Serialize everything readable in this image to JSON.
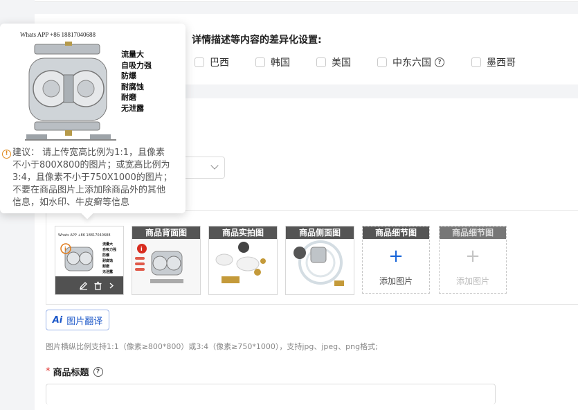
{
  "region_section": {
    "title": "详情描述等内容的差异化设置:",
    "regions": [
      {
        "label": "巴西",
        "checked": false
      },
      {
        "label": "韩国",
        "checked": false
      },
      {
        "label": "美国",
        "checked": false
      },
      {
        "label": "中东六国",
        "checked": false,
        "help_icon": "question-circle-icon"
      },
      {
        "label": "墨西哥",
        "checked": false
      }
    ]
  },
  "popover": {
    "contact": "Whats APP +86 18817040688",
    "features": [
      "流量大",
      "自吸力强",
      "防爆",
      "耐腐蚀",
      "耐磨",
      "无泄露"
    ],
    "tip_icon": "warning-icon",
    "tip_lines": [
      "建议： 请上传宽高比例为1:1，且像素",
      "不小于800X800的图片；或宽高比例为",
      "3:4，且像素不小于750X1000的图片；",
      "不要在商品图片上添加除商品外的其他",
      "信息，如水印、牛皮癣等信息"
    ]
  },
  "images": {
    "slots": [
      {
        "label": "",
        "filled": true,
        "toolbar": [
          "edit-icon",
          "trash-icon",
          "chevron-right-icon"
        ]
      },
      {
        "label": "商品背面图",
        "filled": true
      },
      {
        "label": "商品实拍图",
        "filled": true
      },
      {
        "label": "商品侧面图",
        "filled": true
      },
      {
        "label": "商品细节图",
        "filled": false,
        "add_text": "添加图片",
        "enabled": true
      },
      {
        "label": "商品细节图",
        "filled": false,
        "add_text": "添加图片",
        "enabled": false
      }
    ],
    "translate_button": {
      "icon_text": "Ai",
      "label": "图片翻译"
    },
    "hint": "图片横纵比例支持1:1（像素≥800*800）或3:4（像素≥750*1000），支持jpg、jpeg、png格式;"
  },
  "product_title": {
    "required_mark": "*",
    "label": "商品标题",
    "help_icon": "question-circle-icon"
  },
  "colors": {
    "accent": "#1a66d9",
    "label_bar": "#555555",
    "required": "#e0302c",
    "warning": "#e08a1e"
  }
}
